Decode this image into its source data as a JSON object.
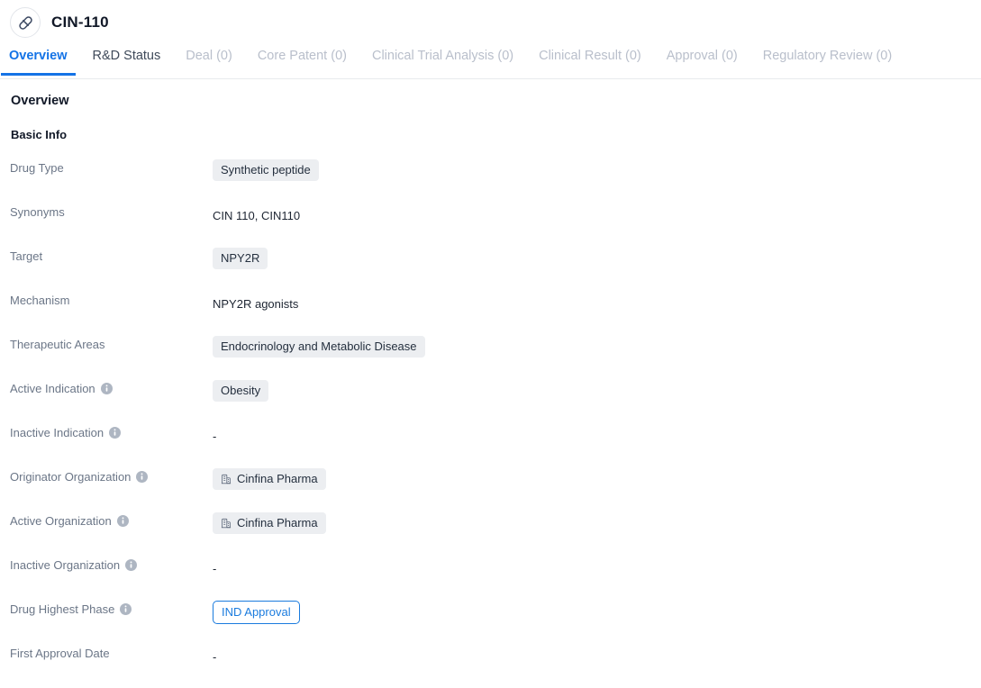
{
  "header": {
    "icon": "pill-icon",
    "title": "CIN-110"
  },
  "tabs": [
    {
      "label": "Overview",
      "state": "active"
    },
    {
      "label": "R&D Status",
      "state": "enabled"
    },
    {
      "label": "Deal (0)",
      "state": "disabled"
    },
    {
      "label": "Core Patent (0)",
      "state": "disabled"
    },
    {
      "label": "Clinical Trial Analysis (0)",
      "state": "disabled"
    },
    {
      "label": "Clinical Result (0)",
      "state": "disabled"
    },
    {
      "label": "Approval (0)",
      "state": "disabled"
    },
    {
      "label": "Regulatory Review (0)",
      "state": "disabled"
    }
  ],
  "main": {
    "section_title": "Overview",
    "subsection_title": "Basic Info",
    "rows": [
      {
        "label": "Drug Type",
        "has_info": false,
        "value_type": "tags",
        "values": [
          "Synthetic peptide"
        ]
      },
      {
        "label": "Synonyms",
        "has_info": false,
        "value_type": "text",
        "text": "CIN 110,  CIN110"
      },
      {
        "label": "Target",
        "has_info": false,
        "value_type": "tags",
        "values": [
          "NPY2R"
        ]
      },
      {
        "label": "Mechanism",
        "has_info": false,
        "value_type": "text",
        "text": "NPY2R agonists"
      },
      {
        "label": "Therapeutic Areas",
        "has_info": false,
        "value_type": "tags",
        "values": [
          "Endocrinology and Metabolic Disease"
        ]
      },
      {
        "label": "Active Indication",
        "has_info": true,
        "value_type": "tags",
        "values": [
          "Obesity"
        ]
      },
      {
        "label": "Inactive Indication",
        "has_info": true,
        "value_type": "empty",
        "text": "-"
      },
      {
        "label": "Originator Organization",
        "has_info": true,
        "value_type": "org_tags",
        "values": [
          "Cinfina Pharma"
        ]
      },
      {
        "label": "Active Organization",
        "has_info": true,
        "value_type": "org_tags",
        "values": [
          "Cinfina Pharma"
        ]
      },
      {
        "label": "Inactive Organization",
        "has_info": true,
        "value_type": "empty",
        "text": "-"
      },
      {
        "label": "Drug Highest Phase",
        "has_info": true,
        "value_type": "badge",
        "values": [
          "IND Approval"
        ]
      },
      {
        "label": "First Approval Date",
        "has_info": false,
        "value_type": "empty",
        "text": "-"
      }
    ]
  },
  "colors": {
    "accent": "#1473e6",
    "badge_border": "#1a7bde",
    "tag_bg": "#eceef1",
    "label_text": "#6b7687",
    "tab_disabled": "#b9bfcb"
  }
}
